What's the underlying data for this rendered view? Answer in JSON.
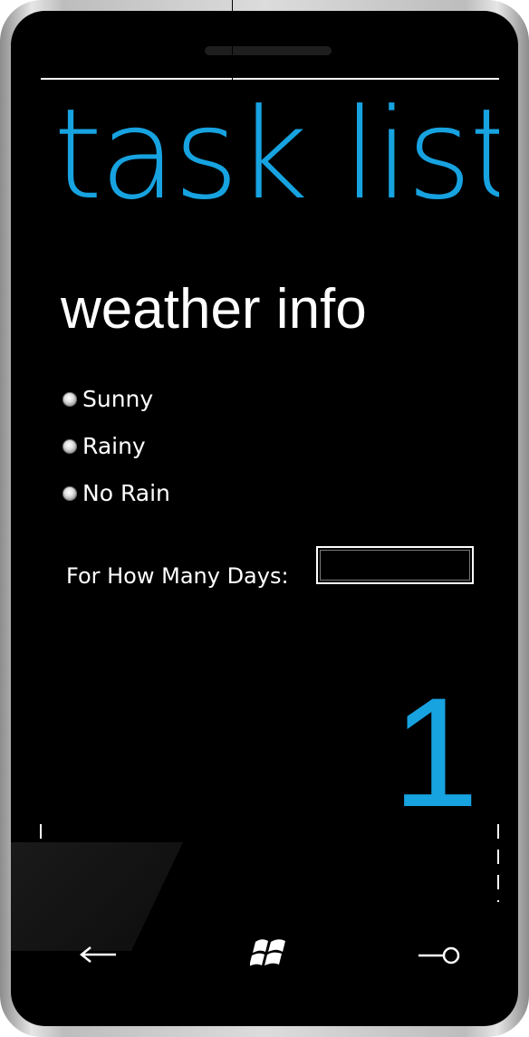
{
  "app": {
    "title": "task list"
  },
  "page": {
    "title": "weather info"
  },
  "weather_options": [
    {
      "label": "Sunny",
      "selected": false
    },
    {
      "label": "Rainy",
      "selected": false
    },
    {
      "label": "No Rain",
      "selected": false
    }
  ],
  "days": {
    "label": "For How Many Days:",
    "value": ""
  },
  "count_display": "1",
  "colors": {
    "accent": "#17a2e0",
    "background": "#000000",
    "foreground": "#ffffff"
  },
  "hardware_buttons": {
    "back": "back-arrow-icon",
    "start": "windows-logo-icon",
    "search": "search-icon"
  }
}
